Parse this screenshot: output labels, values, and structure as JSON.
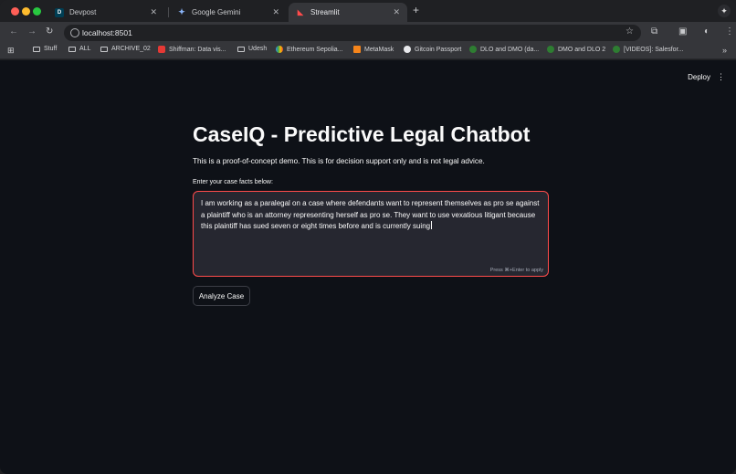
{
  "browser": {
    "tabs": [
      {
        "title": "Devpost",
        "favicon": "D"
      },
      {
        "title": "Google Gemini",
        "favicon": "gemini-icon"
      },
      {
        "title": "Streamlit",
        "favicon": "streamlit-icon"
      }
    ],
    "url": "localhost:8501",
    "bookmarks": [
      {
        "label": "Stuff",
        "icon": "folder-icon"
      },
      {
        "label": "ALL",
        "icon": "folder-icon"
      },
      {
        "label": "ARCHIVE_02",
        "icon": "folder-icon"
      },
      {
        "label": "Shiffman: Data vis...",
        "icon": "youtube-icon"
      },
      {
        "label": "Udesh",
        "icon": "folder-icon"
      },
      {
        "label": "Ethereum Sepolia...",
        "icon": "google-cloud-icon"
      },
      {
        "label": "MetaMask",
        "icon": "metamask-icon"
      },
      {
        "label": "Gitcoin Passport",
        "icon": "gitcoin-icon"
      },
      {
        "label": "DLO and DMO (da...",
        "icon": "site-icon"
      },
      {
        "label": "DMO and DLO 2",
        "icon": "site-icon"
      },
      {
        "label": "[VIDEOS]: Salesfor...",
        "icon": "site-icon"
      }
    ]
  },
  "app": {
    "deploy_label": "Deploy",
    "title": "CaseIQ - Predictive Legal Chatbot",
    "subtitle": "This is a proof-of-concept demo. This is for decision support only and is not legal advice.",
    "input_label": "Enter your case facts below:",
    "input_value": "I am working as a paralegal on a case where defendants want to represent themselves as pro se against a plaintiff who is an attorney representing herself as pro se. They want to use vexatious litigant because this plaintiff has sued seven or eight times before and is currently suing",
    "input_hint": "Press ⌘+Enter to apply",
    "analyze_label": "Analyze Case"
  }
}
